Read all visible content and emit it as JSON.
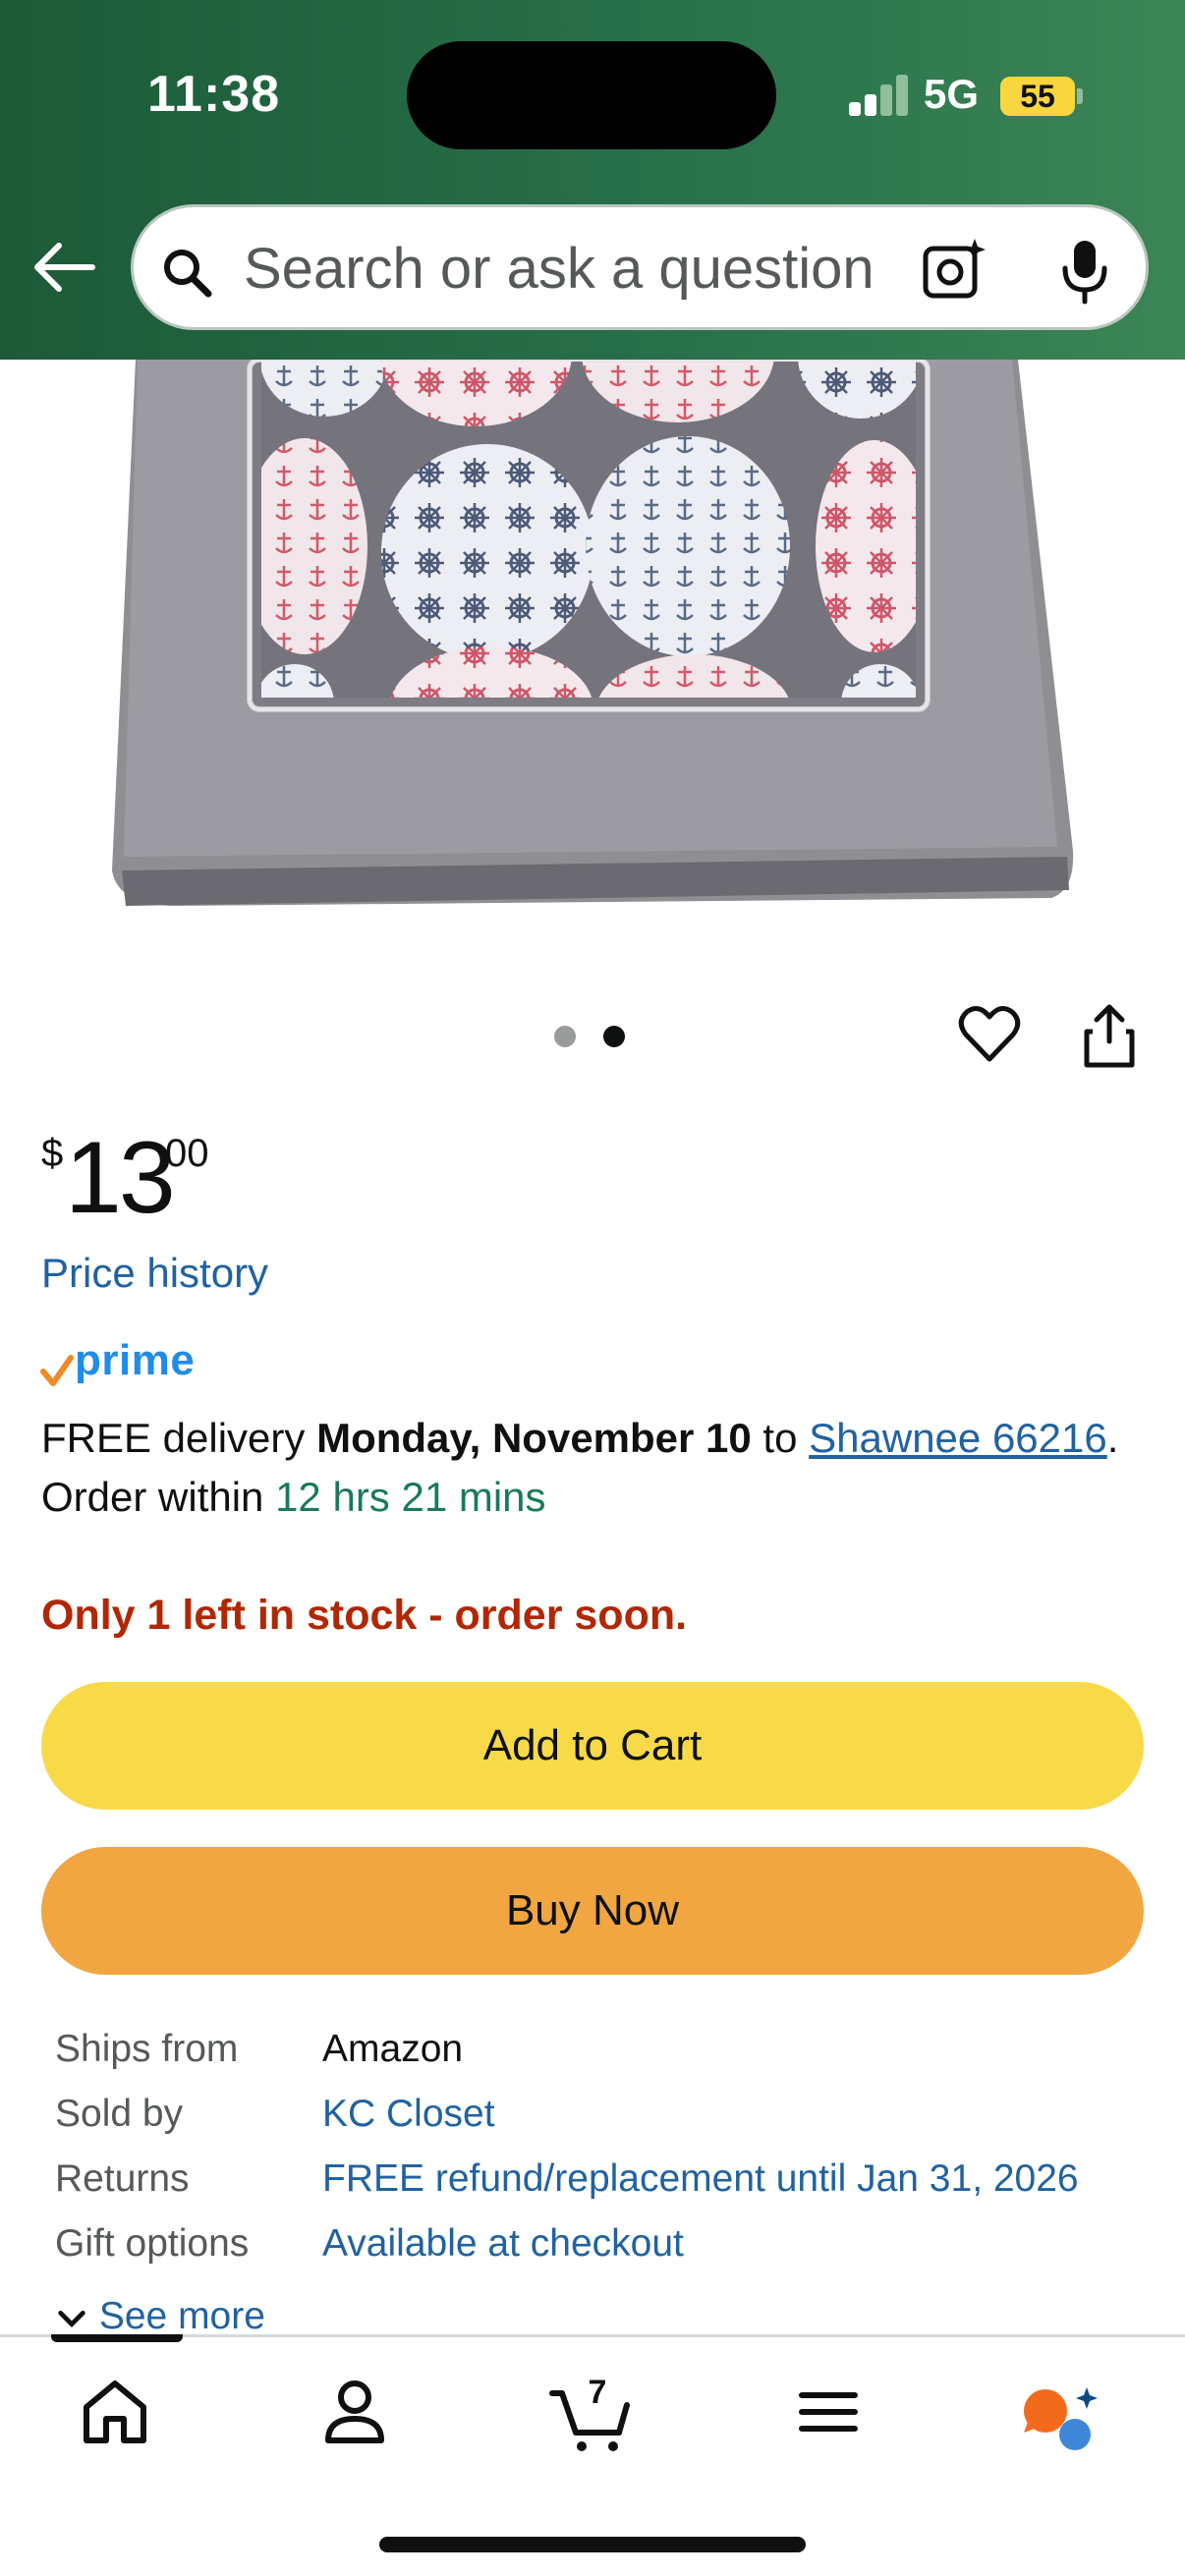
{
  "status_bar": {
    "time": "11:38",
    "network": "5G",
    "battery": "55"
  },
  "header": {
    "search_placeholder": "Search or ask a question",
    "back_icon": "arrow-left-icon",
    "camera_icon": "camera-sparkle-icon",
    "mic_icon": "microphone-icon",
    "background_colors": [
      "#1d5a38",
      "#3b8556"
    ]
  },
  "gallery": {
    "image_count": 2,
    "active_index": 1
  },
  "price": {
    "currency": "$",
    "whole": "13",
    "fraction": "00",
    "history_label": "Price history"
  },
  "prime": {
    "label": "prime"
  },
  "delivery": {
    "prefix": "FREE delivery ",
    "date": "Monday, November 10",
    "to": " to ",
    "location": "Shawnee 66216",
    "order_within_label": ". Order within ",
    "countdown": "12 hrs 21 mins"
  },
  "stock": {
    "message": "Only 1 left in stock - order soon."
  },
  "buttons": {
    "add_to_cart": "Add to Cart",
    "buy_now": "Buy Now"
  },
  "details": [
    {
      "label": "Ships from",
      "value": "Amazon",
      "link": false
    },
    {
      "label": "Sold by",
      "value": "KC Closet",
      "link": true
    },
    {
      "label": "Returns",
      "value": "FREE refund/replacement until Jan 31, 2026",
      "link": true
    },
    {
      "label": "Gift options",
      "value": "Available at checkout",
      "link": true
    }
  ],
  "see_more": "See more",
  "tabbar": {
    "cart_count": "7",
    "tabs": [
      "home-icon",
      "account-icon",
      "cart-icon",
      "menu-icon",
      "rufus-icon"
    ],
    "active_tab": "home-icon"
  },
  "colors": {
    "link": "#2162a1",
    "stock_red": "#b12704",
    "countdown_green": "#19795c",
    "add_to_cart": "#f8da49",
    "buy_now": "#f1a641",
    "prime_blue": "#1f8ce8"
  }
}
